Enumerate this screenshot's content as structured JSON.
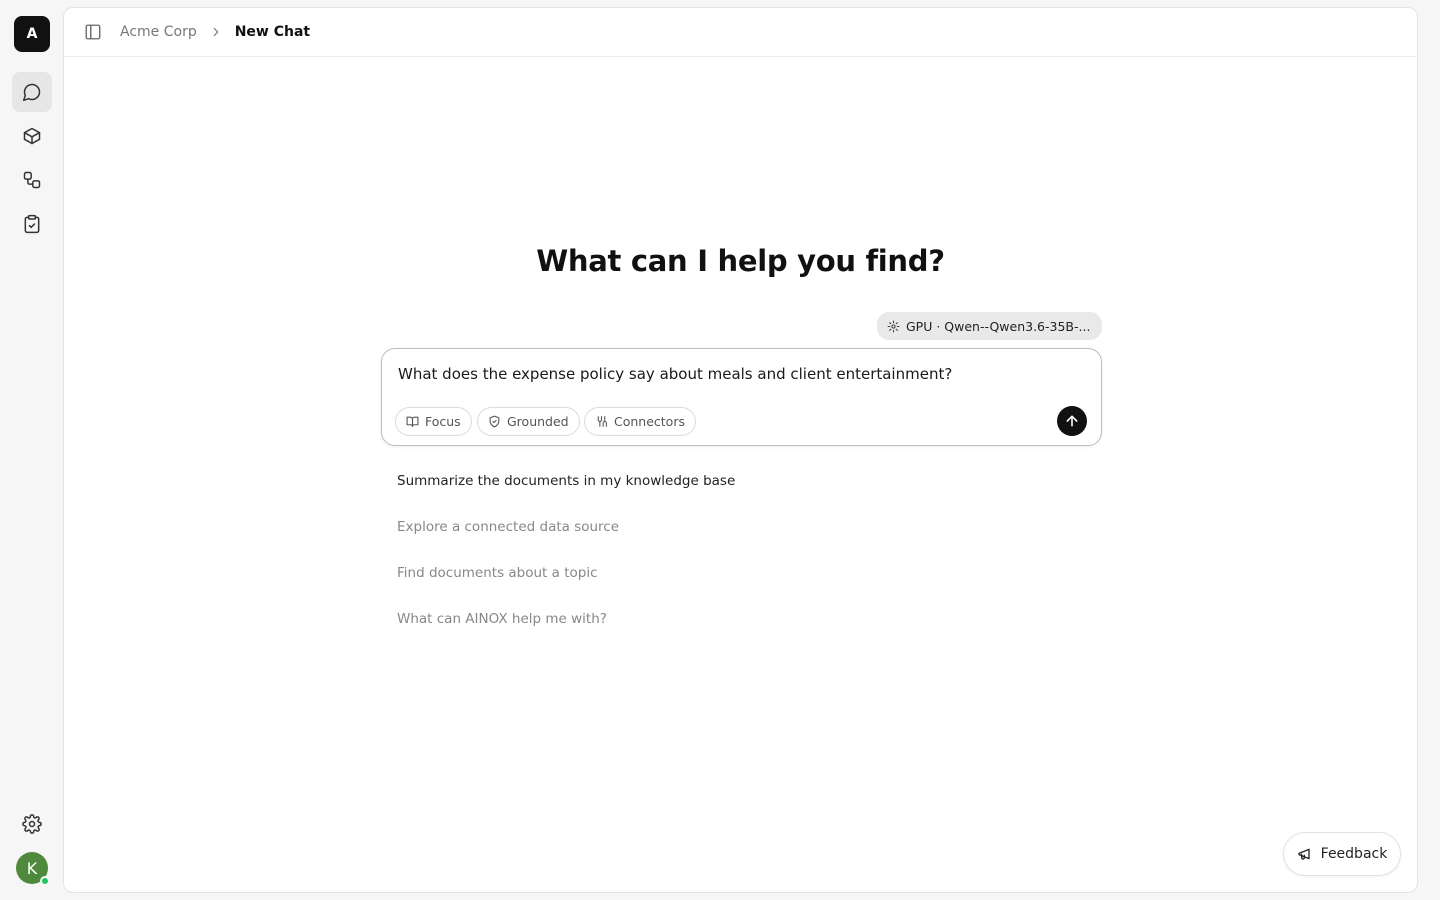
{
  "sidebar": {
    "logo_letter": "A",
    "items": [
      {
        "name": "chat",
        "icon": "chat-bubble-icon",
        "active": true
      },
      {
        "name": "packages",
        "icon": "cube-icon",
        "active": false
      },
      {
        "name": "workflows",
        "icon": "workflow-icon",
        "active": false
      },
      {
        "name": "tasks",
        "icon": "clipboard-check-icon",
        "active": false
      }
    ],
    "settings_icon": "gear-icon",
    "avatar_letter": "K",
    "presence_color": "#22c55e"
  },
  "header": {
    "breadcrumb_parent": "Acme Corp",
    "breadcrumb_current": "New Chat"
  },
  "main": {
    "heading": "What can I help you find?",
    "model_chip": "GPU · Qwen--Qwen3.6-35B-...",
    "composer_value": "What does the expense policy say about meals and client entertainment?",
    "pills": [
      {
        "label": "Focus",
        "icon": "book-icon"
      },
      {
        "label": "Grounded",
        "icon": "shield-check-icon"
      },
      {
        "label": "Connectors",
        "icon": "connectors-icon"
      }
    ],
    "suggestions": [
      "Summarize the documents in my knowledge base",
      "Explore a connected data source",
      "Find documents about a topic",
      "What can AINOX help me with?"
    ]
  },
  "feedback_label": "Feedback",
  "colors": {
    "accent": "#111111",
    "avatar": "#4f8a3c",
    "background": "#f6f6f6"
  }
}
